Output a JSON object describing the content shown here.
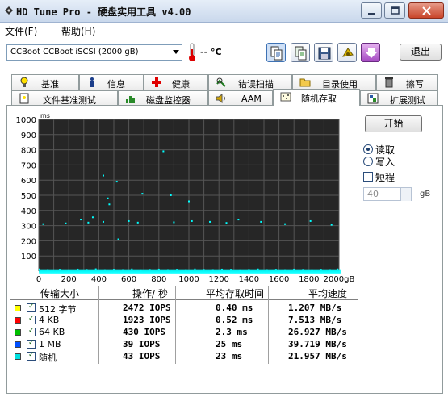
{
  "window": {
    "title": "HD Tune Pro - 硬盘实用工具 v4.00"
  },
  "menu": {
    "items": [
      {
        "label": "文件(F)"
      },
      {
        "label": "帮助(H)"
      }
    ]
  },
  "toolbar": {
    "drive": "CCBoot  CCBoot iSCSI     (2000 gB)",
    "temperature": "--  °C",
    "exit_label": "退出",
    "icons": [
      "copy-info-icon",
      "copy-all-icon",
      "save-icon",
      "options-icon",
      "download-icon"
    ]
  },
  "tabs": {
    "row1": [
      {
        "label": "基准",
        "icon": "lightbulb-icon"
      },
      {
        "label": "信息",
        "icon": "info-icon"
      },
      {
        "label": "健康",
        "icon": "health-cross-icon"
      },
      {
        "label": "错误扫描",
        "icon": "error-scan-icon"
      },
      {
        "label": "目录使用",
        "icon": "folder-icon"
      },
      {
        "label": "擦写",
        "icon": "trash-icon"
      }
    ],
    "row2": [
      {
        "label": "文件基准测试",
        "icon": "file-benchmark-icon"
      },
      {
        "label": "磁盘监控器",
        "icon": "disk-monitor-icon"
      },
      {
        "label": "AAM",
        "icon": "speaker-icon"
      },
      {
        "label": "随机存取",
        "icon": "random-access-icon",
        "active": true
      },
      {
        "label": "扩展测试",
        "icon": "extra-tests-icon"
      }
    ]
  },
  "controls": {
    "start_label": "开始",
    "read_label": "读取",
    "write_label": "写入",
    "short_label": "短程",
    "short_value": "40",
    "short_unit": "gB",
    "mode": "read",
    "short_checked": false
  },
  "chart_data": {
    "type": "scatter",
    "ylabel": "ms",
    "xlabel": "",
    "ylim": [
      0,
      1000
    ],
    "xlim": [
      0,
      2000
    ],
    "x_unit": "gB",
    "y_ticks": [
      "1000",
      "900",
      "800",
      "700",
      "600",
      "500",
      "400",
      "300",
      "200",
      "100"
    ],
    "x_ticks": [
      "0",
      "200",
      "400",
      "600",
      "800",
      "1000",
      "1200",
      "1400",
      "1600",
      "1800",
      "2000gB"
    ],
    "grid": true,
    "background": "#262626",
    "series": [
      {
        "color": "#00ffff",
        "points": [
          [
            5,
            12
          ],
          [
            60,
            8
          ],
          [
            140,
            10
          ],
          [
            200,
            6
          ],
          [
            260,
            11
          ],
          [
            320,
            9
          ],
          [
            380,
            13
          ],
          [
            440,
            7
          ],
          [
            500,
            10
          ],
          [
            560,
            8
          ],
          [
            620,
            12
          ],
          [
            680,
            6
          ],
          [
            740,
            9
          ],
          [
            800,
            11
          ],
          [
            860,
            8
          ],
          [
            920,
            10
          ],
          [
            980,
            7
          ],
          [
            1040,
            12
          ],
          [
            1100,
            9
          ],
          [
            1160,
            8
          ],
          [
            1220,
            11
          ],
          [
            1280,
            10
          ],
          [
            1340,
            6
          ],
          [
            1400,
            9
          ],
          [
            1460,
            12
          ],
          [
            1520,
            8
          ],
          [
            1580,
            10
          ],
          [
            1640,
            7
          ],
          [
            1700,
            11
          ],
          [
            1760,
            9
          ],
          [
            1820,
            6
          ],
          [
            1880,
            10
          ],
          [
            1940,
            8
          ],
          [
            1990,
            12
          ],
          [
            30,
            310
          ],
          [
            180,
            315
          ],
          [
            330,
            320
          ],
          [
            430,
            325
          ],
          [
            600,
            330
          ],
          [
            660,
            320
          ],
          [
            900,
            322
          ],
          [
            1020,
            330
          ],
          [
            1140,
            325
          ],
          [
            1250,
            318
          ],
          [
            1330,
            340
          ],
          [
            1480,
            325
          ],
          [
            1640,
            310
          ],
          [
            1810,
            330
          ],
          [
            1950,
            305
          ],
          [
            430,
            630
          ],
          [
            470,
            440
          ],
          [
            520,
            590
          ],
          [
            690,
            510
          ],
          [
            830,
            790
          ],
          [
            880,
            500
          ],
          [
            460,
            480
          ],
          [
            360,
            355
          ],
          [
            280,
            340
          ],
          [
            530,
            210
          ],
          [
            1000,
            460
          ]
        ]
      }
    ]
  },
  "results": {
    "headers": [
      "传输大小",
      "操作/ 秒",
      "平均存取时间",
      "平均速度"
    ],
    "rows": [
      {
        "color": "#ffff00",
        "size": "512 字节",
        "iops": "2472 IOPS",
        "access": "0.40 ms",
        "speed": "1.207 MB/s"
      },
      {
        "color": "#ff0000",
        "size": "4 KB",
        "iops": "1923 IOPS",
        "access": "0.52 ms",
        "speed": "7.513 MB/s"
      },
      {
        "color": "#00c000",
        "size": "64 KB",
        "iops": "430 IOPS",
        "access": "2.3 ms",
        "speed": "26.927 MB/s"
      },
      {
        "color": "#0050ff",
        "size": "1 MB",
        "iops": "39 IOPS",
        "access": "25 ms",
        "speed": "39.719 MB/s"
      },
      {
        "color": "#00e0e0",
        "size": "随机",
        "iops": "43 IOPS",
        "access": "23 ms",
        "speed": "21.957 MB/s"
      }
    ]
  }
}
